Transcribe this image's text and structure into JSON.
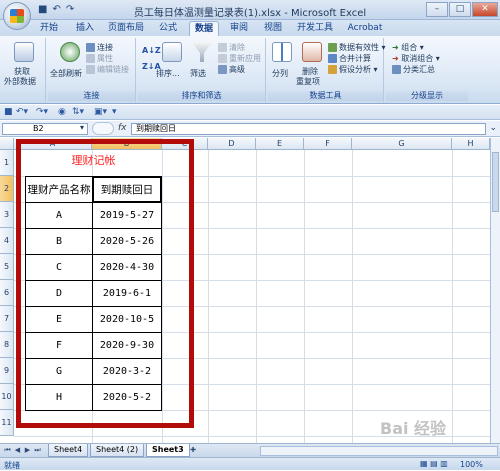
{
  "window": {
    "title": "员工每日体温测量记录表(1).xlsx - Microsoft Excel"
  },
  "ribbon_tabs": [
    "开始",
    "插入",
    "页面布局",
    "公式",
    "数据",
    "审阅",
    "视图",
    "开发工具",
    "Acrobat"
  ],
  "active_tab": "数据",
  "groups": {
    "get_external": {
      "label1": "获取",
      "label2": "外部数据"
    },
    "connections": {
      "refresh_all": "全部刷新",
      "connect": "连接",
      "properties": "属性",
      "edit_links": "编辑链接",
      "group_label": "连接"
    },
    "sort_filter": {
      "sort": "排序...",
      "filter": "筛选",
      "clear": "清除",
      "reapply": "重新应用",
      "advanced": "高级",
      "group_label": "排序和筛选"
    },
    "data_tools": {
      "split": "分列",
      "remove_dup1": "删除",
      "remove_dup2": "重复项",
      "validation": "数据有效性",
      "consolidate": "合并计算",
      "what_if": "假设分析",
      "group_label": "数据工具"
    },
    "outline": {
      "group": "组合",
      "ungroup": "取消组合",
      "subtotal": "分类汇总",
      "group_label": "分级显示"
    }
  },
  "formula_bar": {
    "name_box": "B2",
    "fx": "fx",
    "content": "到期赎回日"
  },
  "columns": [
    "A",
    "B",
    "C",
    "D",
    "E",
    "F",
    "G",
    "H"
  ],
  "rows": [
    "1",
    "2",
    "3",
    "4",
    "5",
    "6",
    "7",
    "8",
    "9",
    "10",
    "11"
  ],
  "table": {
    "title": "理财记帐",
    "headers": [
      "理财产品名称",
      "到期赎回日"
    ],
    "rows": [
      [
        "A",
        "2019-5-27"
      ],
      [
        "B",
        "2020-5-26"
      ],
      [
        "C",
        "2020-4-30"
      ],
      [
        "D",
        "2019-6-1"
      ],
      [
        "E",
        "2020-10-5"
      ],
      [
        "F",
        "2020-9-30"
      ],
      [
        "G",
        "2020-3-2"
      ],
      [
        "H",
        "2020-5-2"
      ]
    ]
  },
  "sheets": [
    "Sheet4",
    "Sheet4 (2)",
    "Sheet3"
  ],
  "active_sheet": "Sheet3",
  "status": {
    "ready": "就绪",
    "zoom": "100%"
  },
  "watermark": "Bai 经验"
}
